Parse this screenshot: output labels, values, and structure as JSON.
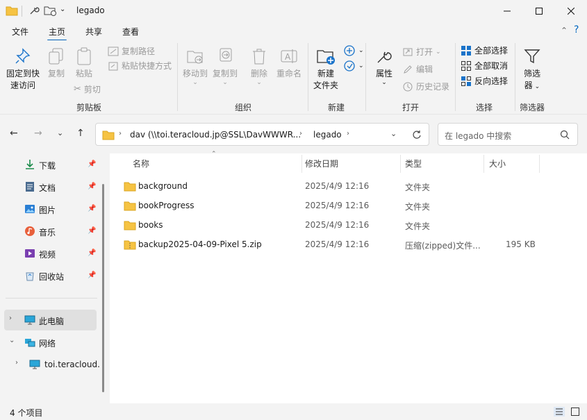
{
  "window": {
    "title": "legado"
  },
  "menu": {
    "tabs": [
      "文件",
      "主页",
      "共享",
      "查看"
    ],
    "active": "主页"
  },
  "ribbon": {
    "clipboard": {
      "pin_label_1": "固定到快",
      "pin_label_2": "速访问",
      "copy": "复制",
      "paste": "粘贴",
      "copy_path": "复制路径",
      "paste_shortcut": "粘贴快捷方式",
      "cut": "剪切",
      "group": "剪贴板"
    },
    "organize": {
      "move_to": "移动到",
      "copy_to": "复制到",
      "delete": "删除",
      "rename": "重命名",
      "group": "组织"
    },
    "new": {
      "new_folder_1": "新建",
      "new_folder_2": "文件夹",
      "group": "新建"
    },
    "open": {
      "properties": "属性",
      "open": "打开",
      "edit": "编辑",
      "history": "历史记录",
      "group": "打开"
    },
    "select": {
      "select_all": "全部选择",
      "select_none": "全部取消",
      "invert": "反向选择",
      "group": "选择"
    },
    "filter": {
      "label_1": "筛选",
      "label_2": "器",
      "group": "筛选器"
    }
  },
  "address": {
    "segments": [
      "dav (\\\\toi.teracloud.jp@SSL\\DavWWWR...",
      "legado"
    ],
    "search_placeholder": "在 legado 中搜索"
  },
  "sidebar": {
    "quick": [
      {
        "label": "下载",
        "icon": "download-icon"
      },
      {
        "label": "文档",
        "icon": "document-icon"
      },
      {
        "label": "图片",
        "icon": "picture-icon"
      },
      {
        "label": "音乐",
        "icon": "music-icon"
      },
      {
        "label": "视频",
        "icon": "video-icon"
      },
      {
        "label": "回收站",
        "icon": "recycle-bin-icon"
      }
    ],
    "this_pc": "此电脑",
    "network": "网络",
    "network_child": "toi.teracloud."
  },
  "columns": {
    "name": "名称",
    "modified": "修改日期",
    "type": "类型",
    "size": "大小"
  },
  "files": [
    {
      "name": "background",
      "modified": "2025/4/9 12:16",
      "type": "文件夹",
      "size": "",
      "icon": "folder-icon"
    },
    {
      "name": "bookProgress",
      "modified": "2025/4/9 12:16",
      "type": "文件夹",
      "size": "",
      "icon": "folder-icon"
    },
    {
      "name": "books",
      "modified": "2025/4/9 12:16",
      "type": "文件夹",
      "size": "",
      "icon": "folder-icon"
    },
    {
      "name": "backup2025-04-09-Pixel 5.zip",
      "modified": "2025/4/9 12:16",
      "type": "压缩(zipped)文件...",
      "size": "195 KB",
      "icon": "zip-icon"
    }
  ],
  "status": {
    "count": "4 个项目"
  },
  "colors": {
    "accent": "#005fb8",
    "folder": "#f6c343",
    "chrome": "#f3f3f3"
  }
}
